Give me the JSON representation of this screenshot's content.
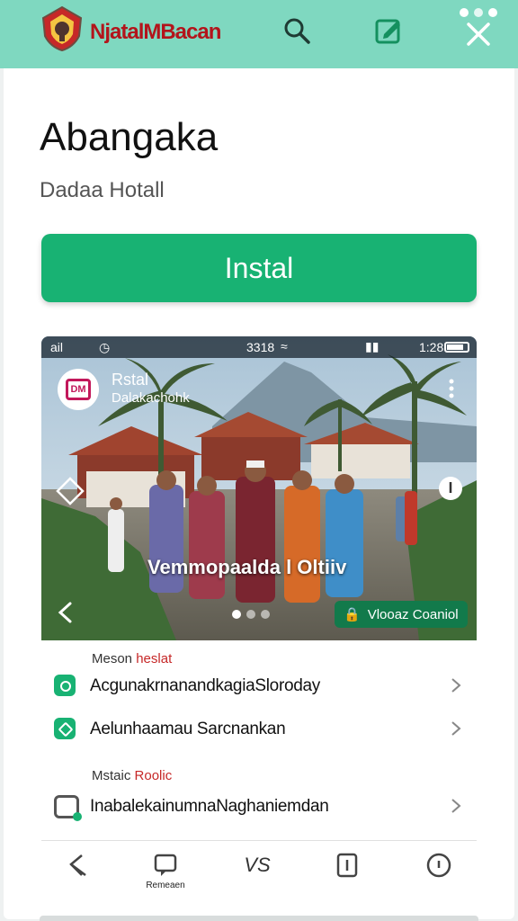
{
  "app_bar": {
    "brand": "NjatalMBacan",
    "icons": [
      "crest-logo",
      "search-icon",
      "edit-icon",
      "close-icon"
    ],
    "background": "#7fd8c0"
  },
  "app": {
    "title": "Abangaka",
    "subtitle": "Dadaa  Hotall",
    "install_label": "Instal",
    "accent": "#18b273"
  },
  "preview": {
    "status": {
      "left": "ail",
      "mid": "3318",
      "time": "1:28",
      "battery_level": 0.7
    },
    "channel_name": "Rstal",
    "channel_sub": "Dalakachohk",
    "channel_badge": "DM",
    "overlay_text": "Vemmopaalda l Oltiiv",
    "control_label": "Vlooaz Coaniol",
    "page_count": 3,
    "active_page": 0
  },
  "sections": [
    {
      "label_prefix": "Meson ",
      "label_accent": "heslat",
      "rows": [
        {
          "text": "AcgunakrnanandkagiaSloroday",
          "icon": "sync-icon"
        },
        {
          "text": "Aelunhaamau Sarcnankan",
          "icon": "edit-icon"
        }
      ]
    },
    {
      "label_prefix": "Mstaic ",
      "label_accent": "Roolic",
      "rows": [
        {
          "text": "InabalekainumnaNaghaniemdan",
          "icon": "calendar-icon"
        }
      ]
    }
  ],
  "bottom_nav": {
    "messages_label": "Remeaen",
    "vs_label": "VS"
  }
}
